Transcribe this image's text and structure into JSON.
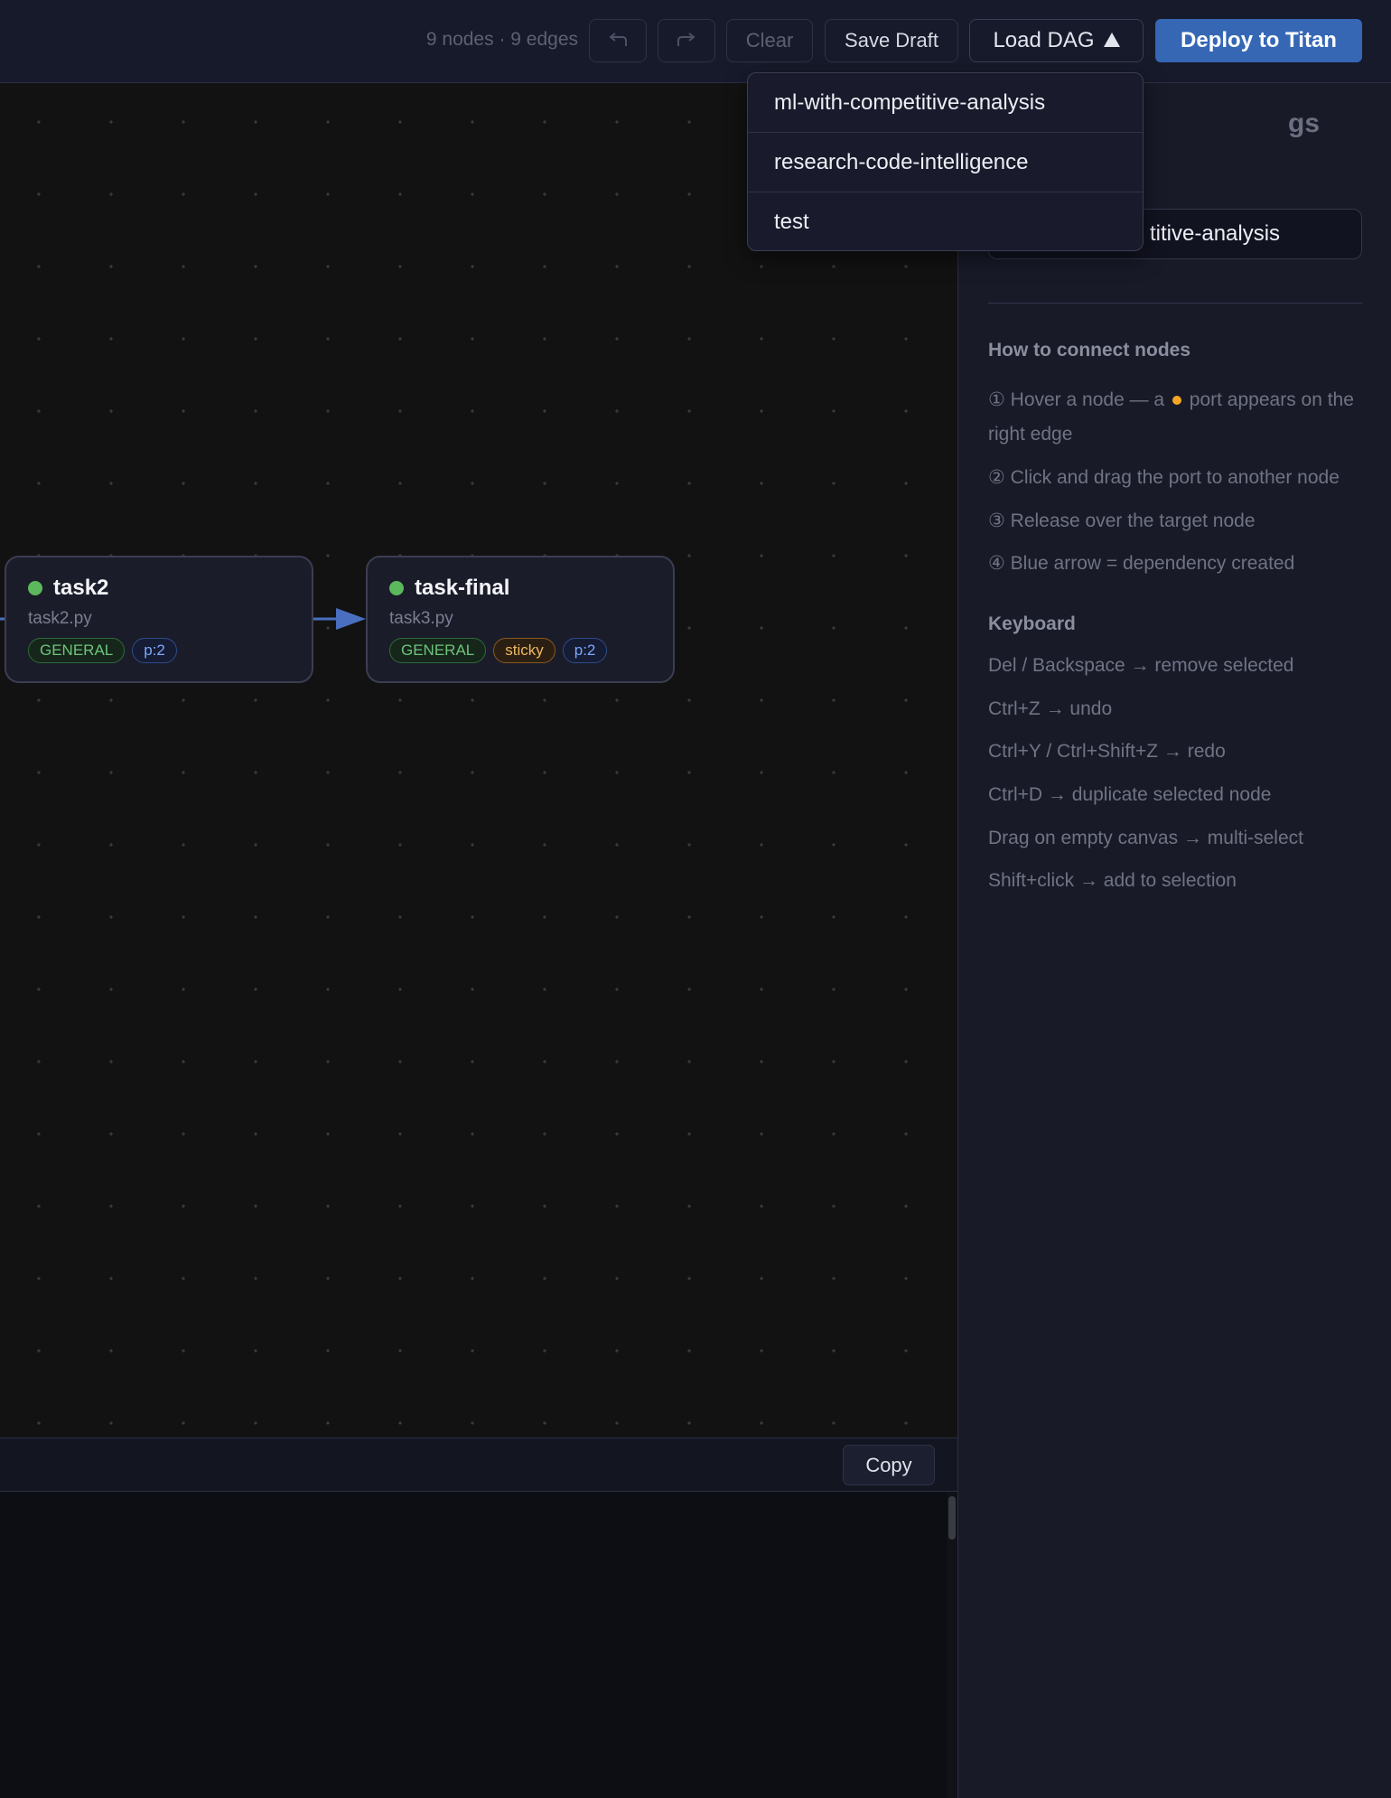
{
  "toolbar": {
    "stats": "9 nodes · 9 edges",
    "undo_icon": "undo-arrow-icon",
    "redo_icon": "redo-arrow-icon",
    "clear_label": "Clear",
    "save_draft_label": "Save Draft",
    "load_dag_label": "Load DAG",
    "deploy_label": "Deploy to Titan"
  },
  "load_dag_menu": {
    "items": [
      "ml-with-competitive-analysis",
      "research-code-intelligence",
      "test"
    ]
  },
  "nodes": [
    {
      "title": "task2",
      "file": "task2.py",
      "status_color": "#5cb85c",
      "tags": [
        {
          "label": "GENERAL",
          "kind": "general"
        },
        {
          "label": "p:2",
          "kind": "priority"
        }
      ]
    },
    {
      "title": "task-final",
      "file": "task3.py",
      "status_color": "#5cb85c",
      "tags": [
        {
          "label": "GENERAL",
          "kind": "general"
        },
        {
          "label": "sticky",
          "kind": "sticky"
        },
        {
          "label": "p:2",
          "kind": "priority"
        }
      ]
    }
  ],
  "output_panel": {
    "copy_label": "Copy"
  },
  "sidebar": {
    "heading_visible": "gs",
    "name_value": "titive-analysis",
    "connect_title": "How to connect nodes",
    "connect_steps": [
      {
        "prefix": "① Hover a node — a",
        "suffix": "port appears on the right edge"
      },
      "② Click and drag the port to another node",
      "③ Release over the target node",
      "④ Blue arrow = dependency created"
    ],
    "keyboard_title": "Keyboard",
    "keyboard_items": [
      "Del / Backspace → remove selected",
      "Ctrl+Z → undo",
      "Ctrl+Y / Ctrl+Shift+Z → redo",
      "Ctrl+D → duplicate selected node",
      "Drag on empty canvas → multi-select",
      "Shift+click → add to selection"
    ]
  },
  "colors": {
    "accent": "#3567b5",
    "edge": "#4a6fc0",
    "status_ok": "#5cb85c",
    "port": "#f5a623"
  }
}
